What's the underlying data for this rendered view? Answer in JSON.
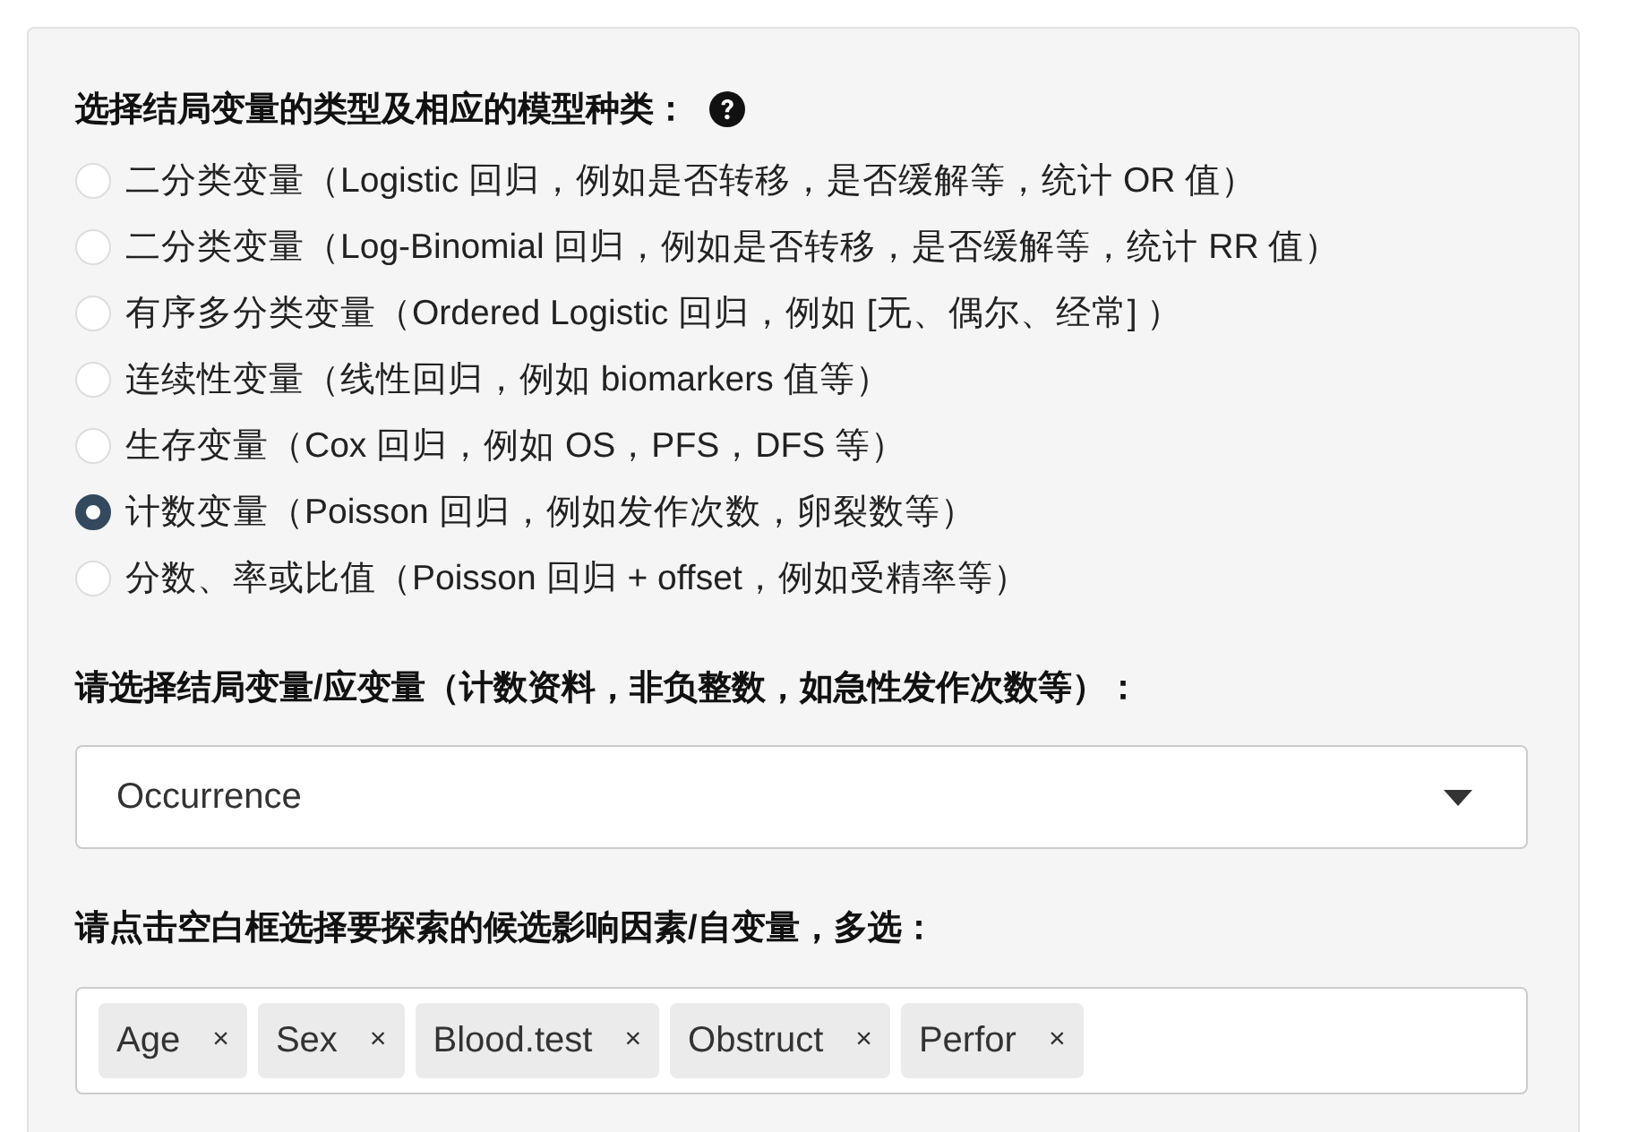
{
  "model_type": {
    "label": "选择结局变量的类型及相应的模型种类：",
    "options": [
      {
        "label": "二分类变量（Logistic 回归，例如是否转移，是否缓解等，统计 OR 值）",
        "selected": false
      },
      {
        "label": "二分类变量（Log-Binomial 回归，例如是否转移，是否缓解等，统计 RR 值）",
        "selected": false
      },
      {
        "label": "有序多分类变量（Ordered Logistic 回归，例如 [无、偶尔、经常] ）",
        "selected": false
      },
      {
        "label": "连续性变量（线性回归，例如 biomarkers 值等）",
        "selected": false
      },
      {
        "label": "生存变量（Cox 回归，例如 OS，PFS，DFS 等）",
        "selected": false
      },
      {
        "label": "计数变量（Poisson 回归，例如发作次数，卵裂数等）",
        "selected": true
      },
      {
        "label": "分数、率或比值（Poisson 回归 + offset，例如受精率等）",
        "selected": false
      }
    ]
  },
  "outcome": {
    "label": "请选择结局变量/应变量（计数资料，非负整数，如急性发作次数等）：",
    "value": "Occurrence"
  },
  "predictors": {
    "label": "请点击空白框选择要探索的候选影响因素/自变量，多选：",
    "tags": [
      {
        "label": "Age",
        "remove": "×"
      },
      {
        "label": "Sex",
        "remove": "×"
      },
      {
        "label": "Blood.test",
        "remove": "×"
      },
      {
        "label": "Obstruct",
        "remove": "×"
      },
      {
        "label": "Perfor",
        "remove": "×"
      }
    ]
  }
}
